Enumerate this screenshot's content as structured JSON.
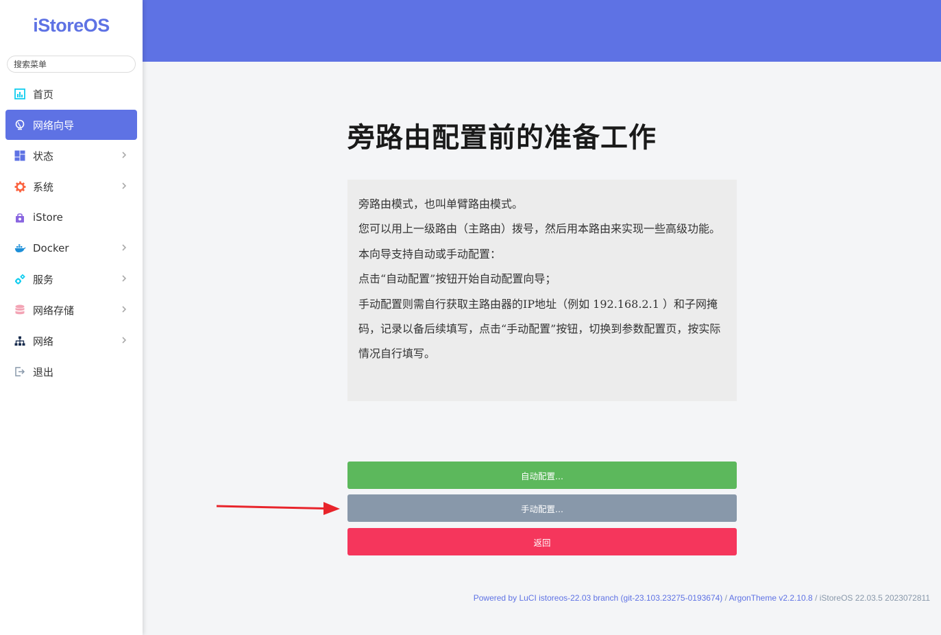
{
  "sidebar": {
    "logo": "iStoreOS",
    "search_placeholder": "搜索菜单",
    "items": [
      {
        "label": "首页",
        "icon": "dashboard-chart-icon",
        "active": false,
        "has_children": false
      },
      {
        "label": "网络向导",
        "icon": "globe-icon",
        "active": true,
        "has_children": false
      },
      {
        "label": "状态",
        "icon": "grid-tiles-icon",
        "active": false,
        "has_children": true
      },
      {
        "label": "系统",
        "icon": "gear-icon",
        "active": false,
        "has_children": true
      },
      {
        "label": "iStore",
        "icon": "store-bag-icon",
        "active": false,
        "has_children": false
      },
      {
        "label": "Docker",
        "icon": "docker-whale-icon",
        "active": false,
        "has_children": true
      },
      {
        "label": "服务",
        "icon": "cogs-icon",
        "active": false,
        "has_children": true
      },
      {
        "label": "网络存储",
        "icon": "database-icon",
        "active": false,
        "has_children": true
      },
      {
        "label": "网络",
        "icon": "network-tree-icon",
        "active": false,
        "has_children": true
      },
      {
        "label": "退出",
        "icon": "logout-icon",
        "active": false,
        "has_children": false
      }
    ]
  },
  "colors": {
    "accent": "#5e72e4",
    "success": "#5cb85c",
    "secondary": "#8898aa",
    "danger": "#f5365c",
    "arrow": "#e8242b"
  },
  "main": {
    "title": "旁路由配置前的准备工作",
    "description": [
      "旁路由模式，也叫单臂路由模式。",
      "您可以用上一级路由（主路由）拨号，然后用本路由来实现一些高级功能。",
      "本向导支持自动或手动配置：",
      "点击“自动配置”按钮开始自动配置向导；",
      "手动配置则需自行获取主路由器的IP地址（例如 192.168.2.1 ）和子网掩码，记录以备后续填写，点击“手动配置”按钮，切换到参数配置页，按实际情况自行填写。"
    ],
    "buttons": {
      "auto": "自动配置...",
      "manual": "手动配置...",
      "back": "返回"
    }
  },
  "footer": {
    "luci": "Powered by LuCI istoreos-22.03 branch (git-23.103.23275-0193674)",
    "sep1": " / ",
    "theme": "ArgonTheme v2.2.10.8",
    "sep2": " / ",
    "version": "iStoreOS 22.03.5 2023072811"
  }
}
